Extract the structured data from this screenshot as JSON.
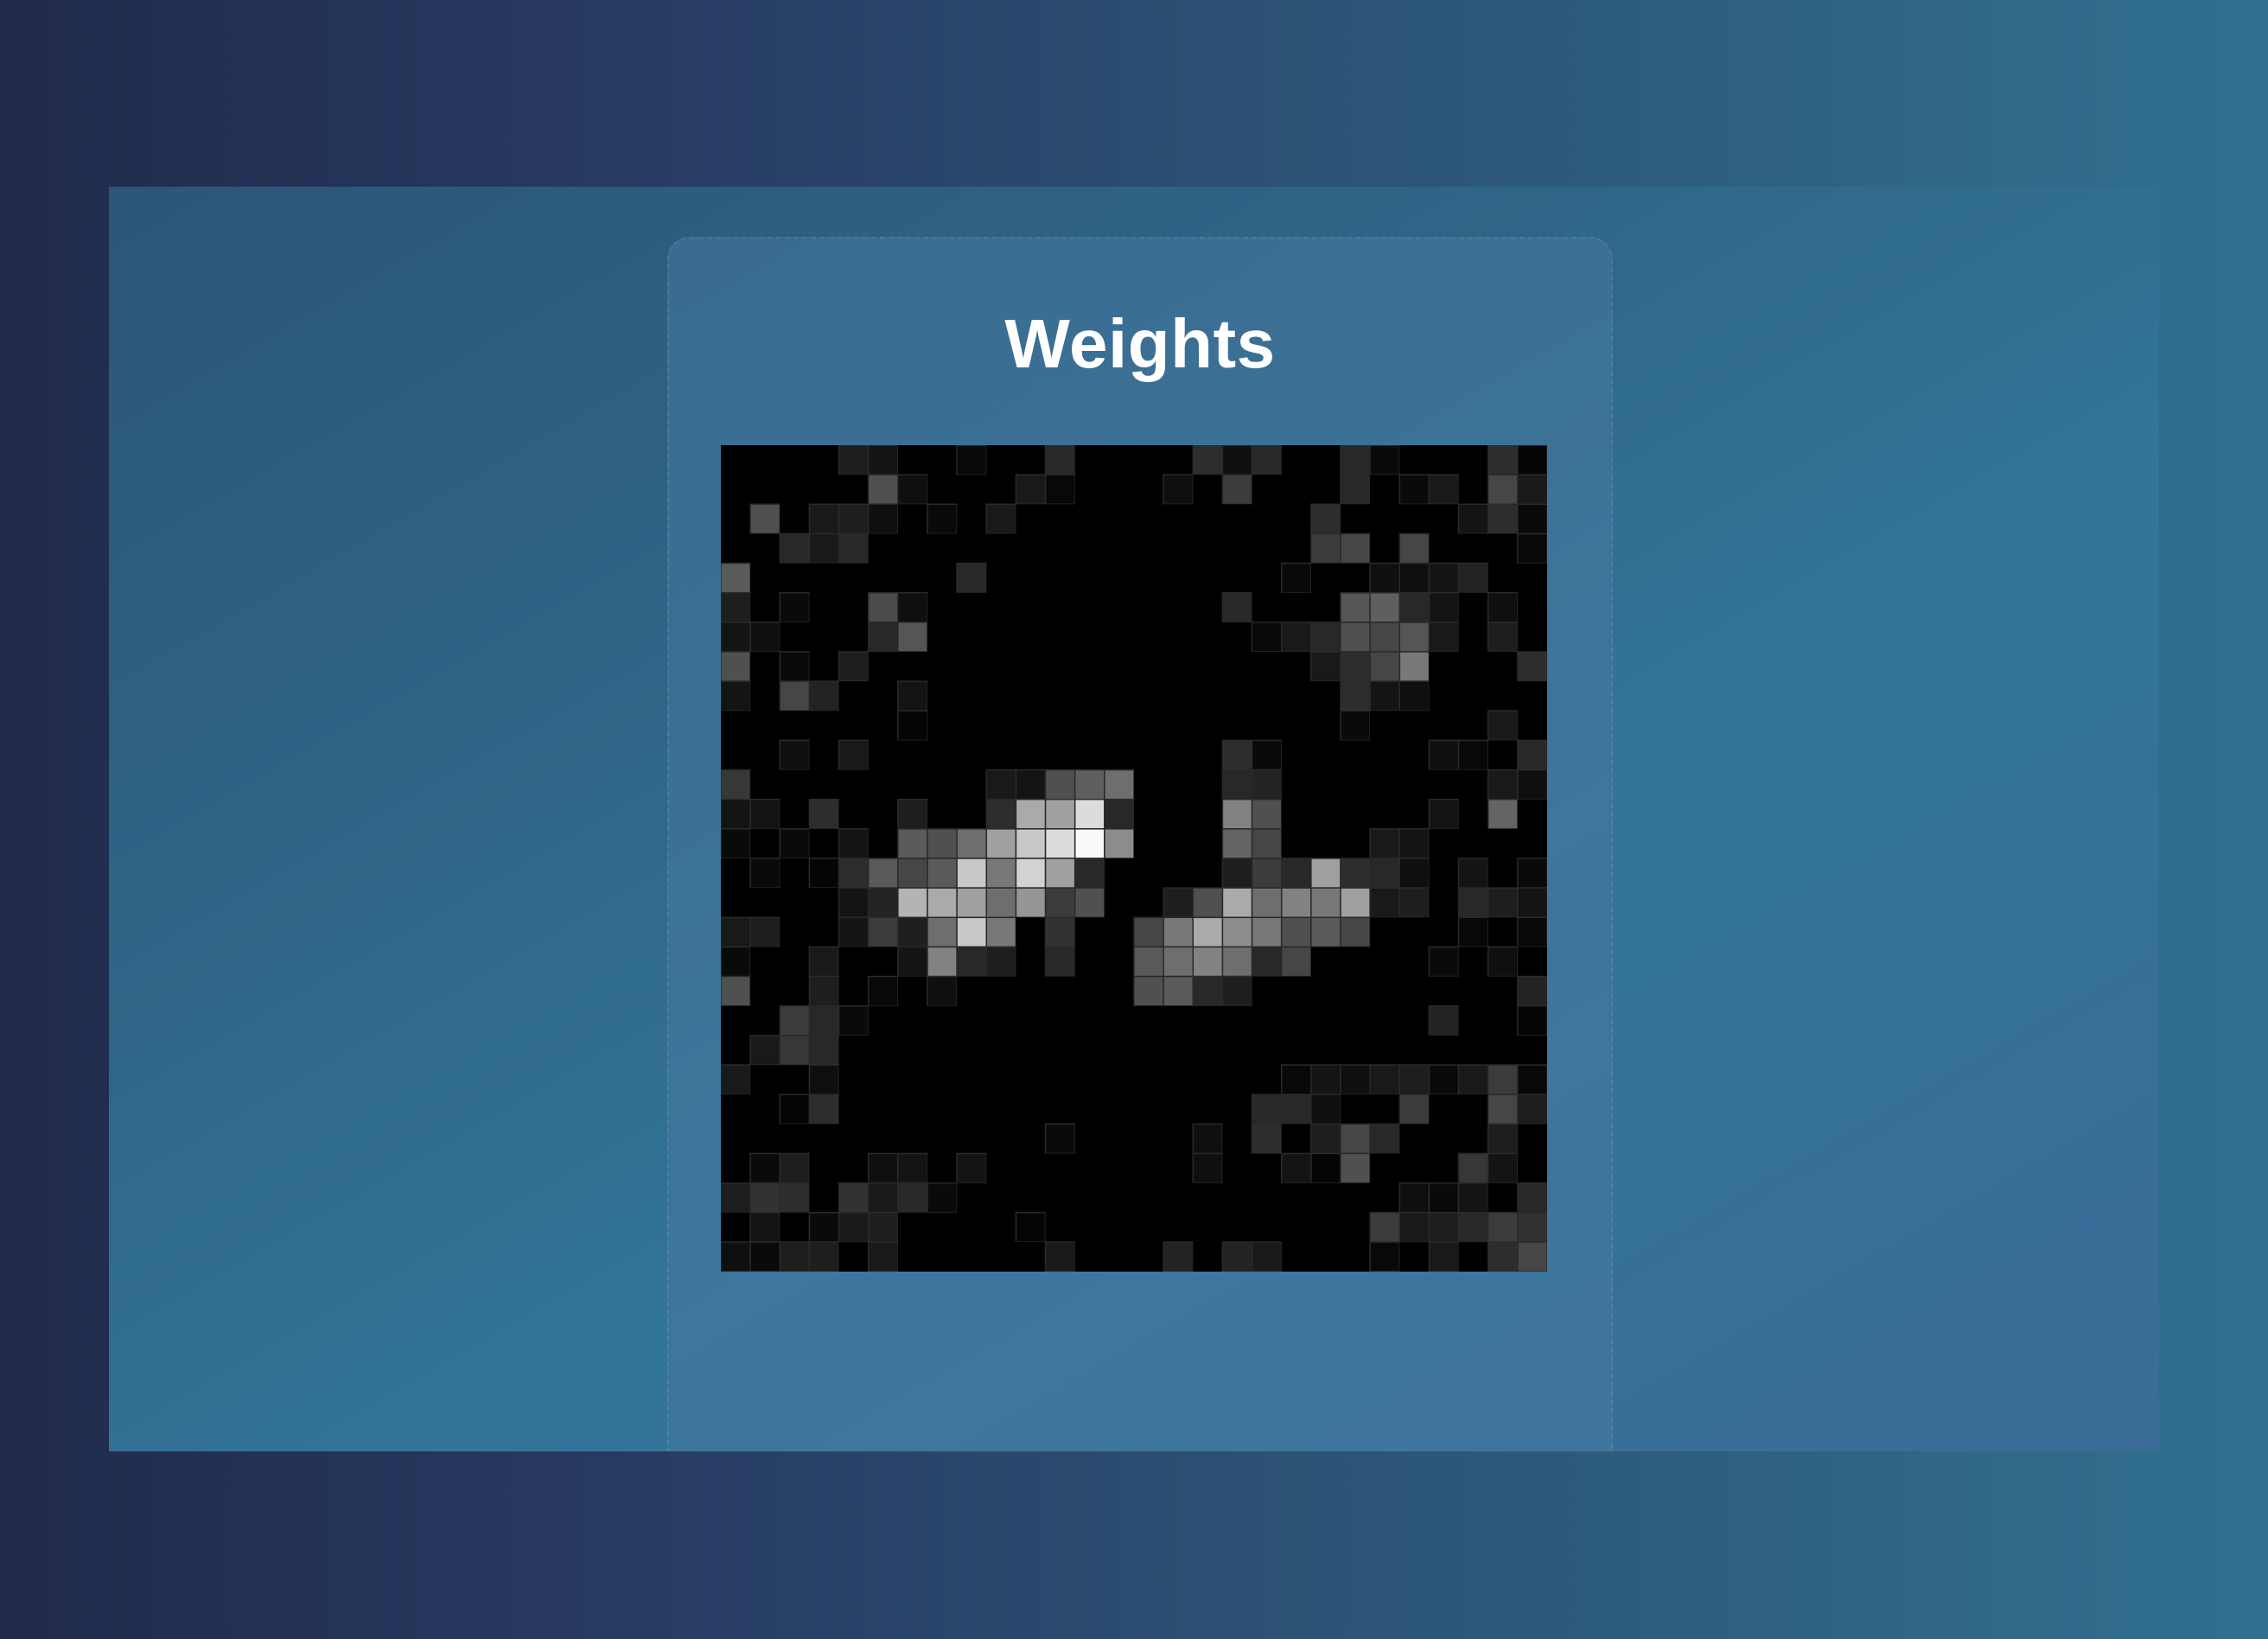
{
  "card": {
    "title": "Weights"
  },
  "chart_data": {
    "type": "heatmap",
    "colormap": "grayscale",
    "value_range": [
      0,
      255
    ],
    "cell_border_color": "#2a2a2a",
    "background": "#000000",
    "rows": 28,
    "cols": 28,
    "values": [
      [
        0,
        0,
        0,
        0,
        30,
        20,
        0,
        0,
        8,
        0,
        0,
        40,
        0,
        0,
        0,
        0,
        45,
        15,
        40,
        0,
        0,
        40,
        10,
        0,
        0,
        0,
        45,
        5
      ],
      [
        0,
        0,
        0,
        0,
        0,
        80,
        15,
        0,
        0,
        0,
        25,
        8,
        0,
        0,
        0,
        15,
        0,
        60,
        0,
        0,
        0,
        40,
        0,
        10,
        25,
        0,
        70,
        25
      ],
      [
        0,
        80,
        0,
        25,
        30,
        15,
        0,
        10,
        0,
        25,
        0,
        0,
        0,
        0,
        0,
        0,
        0,
        0,
        0,
        0,
        45,
        0,
        0,
        0,
        0,
        20,
        45,
        10
      ],
      [
        0,
        0,
        40,
        25,
        40,
        0,
        0,
        0,
        0,
        0,
        0,
        0,
        0,
        0,
        0,
        0,
        0,
        0,
        0,
        0,
        60,
        70,
        0,
        70,
        0,
        0,
        0,
        8
      ],
      [
        90,
        0,
        0,
        0,
        0,
        0,
        0,
        0,
        40,
        0,
        0,
        0,
        0,
        0,
        0,
        0,
        0,
        0,
        0,
        10,
        0,
        0,
        15,
        15,
        20,
        35,
        0,
        0
      ],
      [
        30,
        0,
        10,
        0,
        0,
        75,
        15,
        0,
        0,
        0,
        0,
        0,
        0,
        0,
        0,
        0,
        0,
        40,
        0,
        0,
        0,
        85,
        95,
        40,
        20,
        0,
        15,
        0
      ],
      [
        20,
        15,
        0,
        0,
        0,
        40,
        85,
        0,
        0,
        0,
        0,
        0,
        0,
        0,
        0,
        0,
        0,
        0,
        8,
        25,
        40,
        80,
        70,
        85,
        25,
        0,
        30,
        0
      ],
      [
        80,
        0,
        10,
        0,
        30,
        0,
        0,
        0,
        0,
        0,
        0,
        0,
        0,
        0,
        0,
        0,
        0,
        0,
        0,
        0,
        25,
        45,
        70,
        120,
        0,
        0,
        0,
        45
      ],
      [
        20,
        0,
        70,
        35,
        0,
        0,
        20,
        0,
        0,
        0,
        0,
        0,
        0,
        0,
        0,
        0,
        0,
        0,
        0,
        0,
        0,
        45,
        20,
        15,
        0,
        0,
        0,
        0
      ],
      [
        0,
        0,
        0,
        0,
        0,
        0,
        5,
        0,
        0,
        0,
        0,
        0,
        0,
        0,
        0,
        0,
        0,
        0,
        0,
        0,
        0,
        10,
        0,
        0,
        0,
        0,
        25,
        0
      ],
      [
        0,
        0,
        15,
        0,
        25,
        0,
        0,
        0,
        0,
        0,
        0,
        0,
        0,
        0,
        0,
        0,
        0,
        45,
        10,
        0,
        0,
        0,
        0,
        0,
        15,
        8,
        0,
        40
      ],
      [
        55,
        0,
        0,
        0,
        0,
        0,
        0,
        0,
        0,
        25,
        20,
        80,
        95,
        110,
        0,
        0,
        0,
        40,
        35,
        0,
        0,
        0,
        0,
        0,
        0,
        0,
        25,
        15
      ],
      [
        20,
        20,
        0,
        45,
        0,
        0,
        30,
        0,
        0,
        45,
        170,
        160,
        220,
        40,
        0,
        0,
        0,
        130,
        80,
        0,
        0,
        0,
        0,
        0,
        20,
        0,
        100,
        0
      ],
      [
        10,
        0,
        10,
        0,
        20,
        0,
        90,
        80,
        110,
        160,
        200,
        220,
        250,
        140,
        0,
        0,
        0,
        100,
        70,
        0,
        0,
        0,
        25,
        20,
        0,
        0,
        0,
        0
      ],
      [
        0,
        10,
        0,
        5,
        45,
        90,
        70,
        90,
        200,
        120,
        210,
        160,
        40,
        0,
        0,
        0,
        0,
        30,
        60,
        40,
        160,
        45,
        40,
        15,
        0,
        20,
        0,
        10
      ],
      [
        0,
        0,
        0,
        0,
        20,
        35,
        180,
        170,
        160,
        110,
        150,
        60,
        80,
        0,
        0,
        30,
        80,
        170,
        110,
        130,
        120,
        160,
        25,
        30,
        0,
        40,
        30,
        20
      ],
      [
        25,
        30,
        0,
        0,
        20,
        60,
        30,
        110,
        200,
        120,
        0,
        50,
        0,
        0,
        70,
        120,
        170,
        140,
        120,
        80,
        90,
        70,
        0,
        0,
        0,
        8,
        0,
        8
      ],
      [
        10,
        0,
        0,
        25,
        0,
        0,
        20,
        130,
        40,
        30,
        0,
        40,
        0,
        0,
        90,
        110,
        130,
        110,
        40,
        70,
        0,
        0,
        0,
        0,
        10,
        0,
        15,
        0
      ],
      [
        80,
        0,
        0,
        30,
        0,
        8,
        0,
        15,
        0,
        0,
        0,
        0,
        0,
        0,
        80,
        90,
        40,
        30,
        0,
        0,
        0,
        0,
        0,
        0,
        0,
        0,
        0,
        35
      ],
      [
        0,
        0,
        60,
        40,
        10,
        0,
        0,
        0,
        0,
        0,
        0,
        0,
        0,
        0,
        0,
        0,
        0,
        0,
        0,
        0,
        0,
        0,
        0,
        0,
        35,
        0,
        0,
        5
      ],
      [
        0,
        25,
        55,
        40,
        0,
        0,
        0,
        0,
        0,
        0,
        0,
        0,
        0,
        0,
        0,
        0,
        0,
        0,
        0,
        0,
        0,
        0,
        0,
        0,
        0,
        0,
        0,
        0
      ],
      [
        25,
        0,
        0,
        15,
        0,
        0,
        0,
        0,
        0,
        0,
        0,
        0,
        0,
        0,
        0,
        0,
        0,
        0,
        0,
        8,
        20,
        15,
        25,
        30,
        10,
        25,
        60,
        8
      ],
      [
        0,
        0,
        5,
        45,
        0,
        0,
        0,
        0,
        0,
        0,
        0,
        0,
        0,
        0,
        0,
        0,
        0,
        0,
        40,
        40,
        15,
        0,
        0,
        60,
        0,
        0,
        70,
        30
      ],
      [
        0,
        0,
        0,
        0,
        0,
        0,
        0,
        0,
        0,
        0,
        0,
        10,
        0,
        0,
        0,
        0,
        15,
        0,
        45,
        0,
        30,
        70,
        40,
        0,
        0,
        0,
        30,
        0
      ],
      [
        0,
        10,
        30,
        0,
        0,
        15,
        20,
        0,
        20,
        0,
        0,
        0,
        0,
        0,
        0,
        0,
        15,
        0,
        0,
        20,
        5,
        80,
        0,
        0,
        0,
        55,
        20,
        0
      ],
      [
        30,
        50,
        45,
        0,
        50,
        25,
        40,
        10,
        0,
        0,
        0,
        0,
        0,
        0,
        0,
        0,
        0,
        0,
        0,
        0,
        0,
        0,
        0,
        15,
        10,
        20,
        0,
        40
      ],
      [
        0,
        20,
        0,
        10,
        25,
        30,
        0,
        0,
        0,
        0,
        5,
        0,
        0,
        0,
        0,
        0,
        0,
        0,
        0,
        0,
        0,
        0,
        60,
        25,
        30,
        40,
        60,
        50
      ],
      [
        15,
        10,
        30,
        30,
        0,
        25,
        0,
        0,
        0,
        0,
        0,
        25,
        0,
        0,
        0,
        35,
        0,
        35,
        25,
        0,
        0,
        0,
        8,
        0,
        25,
        0,
        45,
        70
      ]
    ]
  }
}
